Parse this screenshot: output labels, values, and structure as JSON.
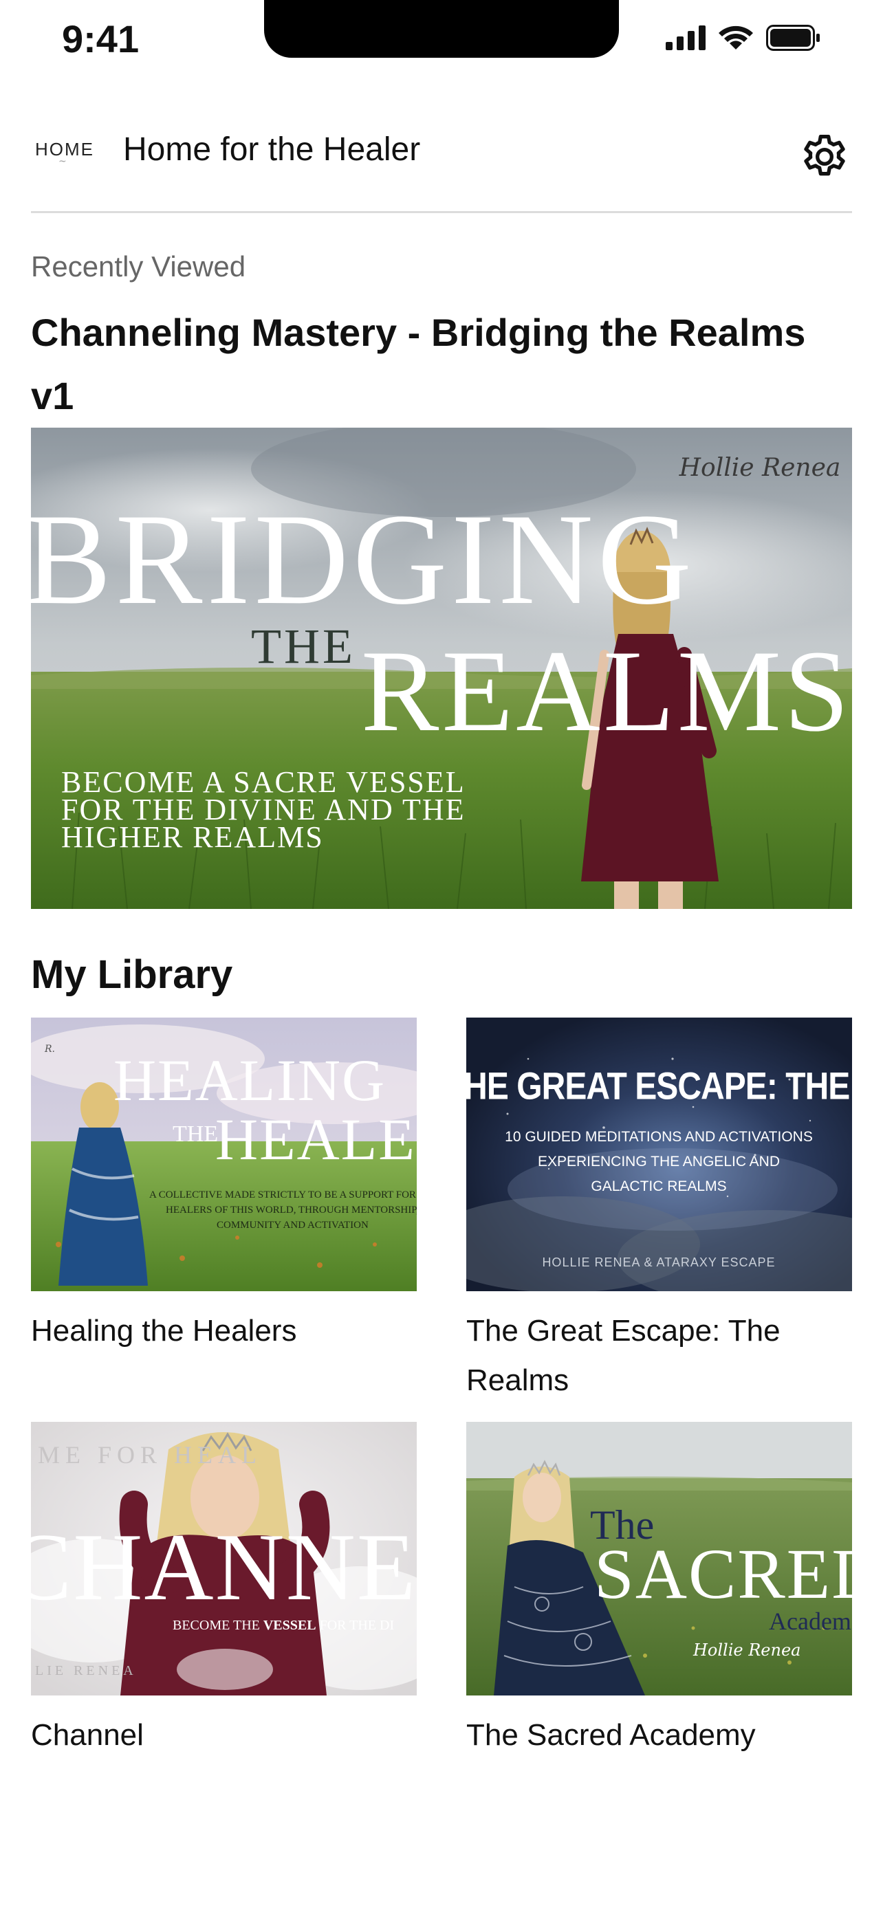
{
  "status_bar": {
    "time": "9:41"
  },
  "header": {
    "logo_text": "HOME",
    "title": "Home for the Healer"
  },
  "recently_viewed": {
    "label": "Recently Viewed",
    "course_title": "Channeling Mastery - Bridging the Realms v1",
    "image": {
      "signature": "Hollie Renea",
      "headline_top": "BRIDGING",
      "headline_mid": "THE",
      "headline_bottom": "REALMS",
      "tagline_1": "BECOME A SACRE VESSEL",
      "tagline_2": "FOR THE DIVINE AND THE",
      "tagline_3": "HIGHER REALMS"
    }
  },
  "library": {
    "title": "My Library",
    "items": [
      {
        "label": "Healing the Healers",
        "image": {
          "line1": "HEALING",
          "line2": "THE",
          "line3": "HEALER",
          "sub1": "A COLLECTIVE MADE STRICTLY TO BE A SUPPORT FOR T",
          "sub2": "HEALERS OF THIS WORLD, THROUGH MENTORSHIP,",
          "sub3": "COMMUNITY AND ACTIVATION"
        }
      },
      {
        "label": "The Great Escape: The Realms",
        "image": {
          "headline": "HE GREAT ESCAPE: THE REALM",
          "sub1": "10 GUIDED MEDITATIONS AND ACTIVATIONS",
          "sub2": "EXPERIENCING THE ANGELIC AND",
          "sub3": "GALACTIC REALMS",
          "credit": "HOLLIE RENEA & ATARAXY ESCAPE"
        }
      },
      {
        "label": "Channel",
        "image": {
          "top": "ME FOR     HEAL",
          "headline": "CHANNEL",
          "sub_a": "BECOME THE ",
          "sub_b": "VESSEL",
          "sub_c": " FOR THE DI",
          "credit": "LIE RENEA"
        }
      },
      {
        "label": "The Sacred Academy",
        "image": {
          "line1": "The",
          "line2": "SACRED",
          "line3": "Academ",
          "signature": "Hollie Renea"
        }
      }
    ]
  },
  "colors": {
    "header_divider": "#dcdcdc",
    "text_primary": "#111111",
    "text_secondary": "#666666",
    "night_sky": "#1d2a44",
    "field_green": "#5f8a2e"
  }
}
